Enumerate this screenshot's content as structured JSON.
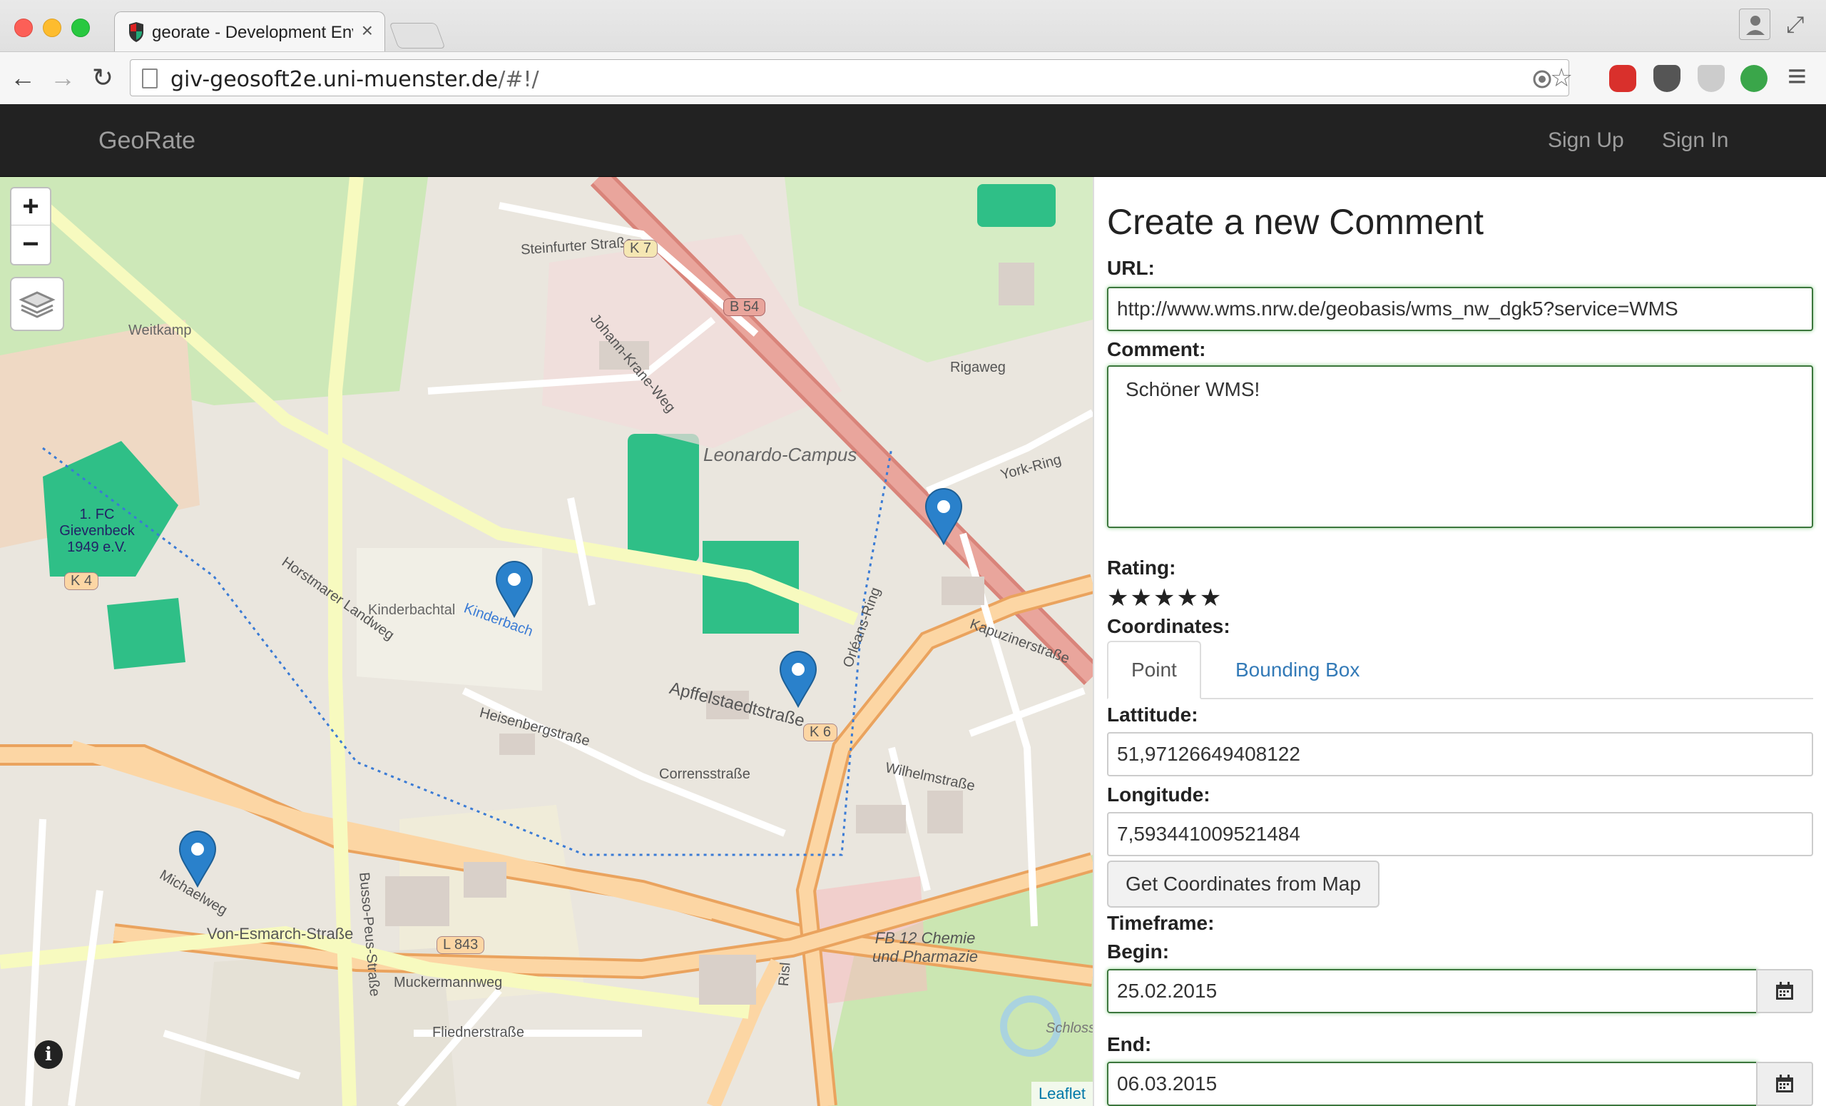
{
  "browser": {
    "tab_title": "georate - Development Environment",
    "close_glyph": "×",
    "url_host": "giv-geosoft2e.uni-muenster.de",
    "url_path": "/#!/",
    "back_glyph": "←",
    "forward_glyph": "→",
    "reload_glyph": "↻",
    "menu_glyph": "≡"
  },
  "navbar": {
    "brand": "GeoRate",
    "signup": "Sign Up",
    "signin": "Sign In"
  },
  "map": {
    "zoom_in": "+",
    "zoom_out": "−",
    "info": "i",
    "attribution": "Leaflet",
    "street_labels": [
      "Steinfurter Straße",
      "K 7",
      "B 54",
      "Weitkamp",
      "Horstmarer Landweg",
      "Johann-Krane-Weg",
      "Leonardo-Campus",
      "York-Ring",
      "Rigaweg",
      "1. FC Gievenbeck 1949 e.V.",
      "K 4",
      "Kinderbachtal",
      "Kinderbach",
      "Apffelstaedtstraße",
      "K 6",
      "Orléans-Ring",
      "Heisenbergstraße",
      "Corrensstraße",
      "Wilhelmstraße",
      "Busso-Peus-Straße",
      "Von-Esmarch-Straße",
      "L 843",
      "Muckermannweg",
      "Fliednerstraße",
      "FB 12 Chemie und Pharmazie",
      "Schloss",
      "Michaelweg",
      "Kapuzinerstraße",
      "Risl"
    ]
  },
  "form": {
    "title": "Create a new Comment",
    "url_label": "URL:",
    "url_value": "http://www.wms.nrw.de/geobasis/wms_nw_dgk5?service=WMS",
    "comment_label": "Comment:",
    "comment_value": "Schöner WMS!",
    "rating_label": "Rating:",
    "rating_stars": "★★★★★",
    "rating_value": 5,
    "coordinates_label": "Coordinates:",
    "tabs": [
      "Point",
      "Bounding Box"
    ],
    "lat_label": "Lattitude:",
    "lat_value": "51,97126649408122",
    "lon_label": "Longitude:",
    "lon_value": "7,593441009521484",
    "get_coords_button": "Get Coordinates from Map",
    "timeframe_label": "Timeframe:",
    "begin_label": "Begin:",
    "begin_value": "25.02.2015",
    "end_label": "End:",
    "end_value": "06.03.2015"
  },
  "colors": {
    "navbar_bg": "#222222",
    "link_blue": "#337ab7",
    "valid_green": "#3c763d",
    "marker_blue": "#2a81cb"
  }
}
